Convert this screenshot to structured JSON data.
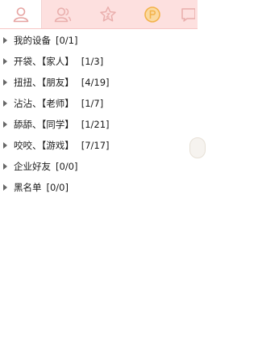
{
  "tabs": [
    {
      "icon": "contact-icon",
      "active": true
    },
    {
      "icon": "group-icon",
      "active": false
    },
    {
      "icon": "star-icon",
      "active": false
    },
    {
      "icon": "qzone-icon",
      "active": false
    },
    {
      "icon": "message-icon",
      "active": false
    }
  ],
  "groups": [
    {
      "name": "我的设备",
      "count": "[0/1]"
    },
    {
      "name": "开袋、【家人】",
      "count": "[1/3]"
    },
    {
      "name": "扭扭、【朋友】",
      "count": "[4/19]"
    },
    {
      "name": "沾沾、【老师】",
      "count": "[1/7]"
    },
    {
      "name": "舔舔、【同学】",
      "count": "[1/21]"
    },
    {
      "name": "咬咬、【游戏】",
      "count": "[7/17]"
    },
    {
      "name": "企业好友",
      "count": "[0/0]"
    },
    {
      "name": "黑名单",
      "count": "[0/0]"
    }
  ],
  "colors": {
    "tabbar_bg": "#fde0df",
    "icon_stroke": "#e9a9a7",
    "qzone_accent": "#f3b24a",
    "arrow": "#666666"
  }
}
